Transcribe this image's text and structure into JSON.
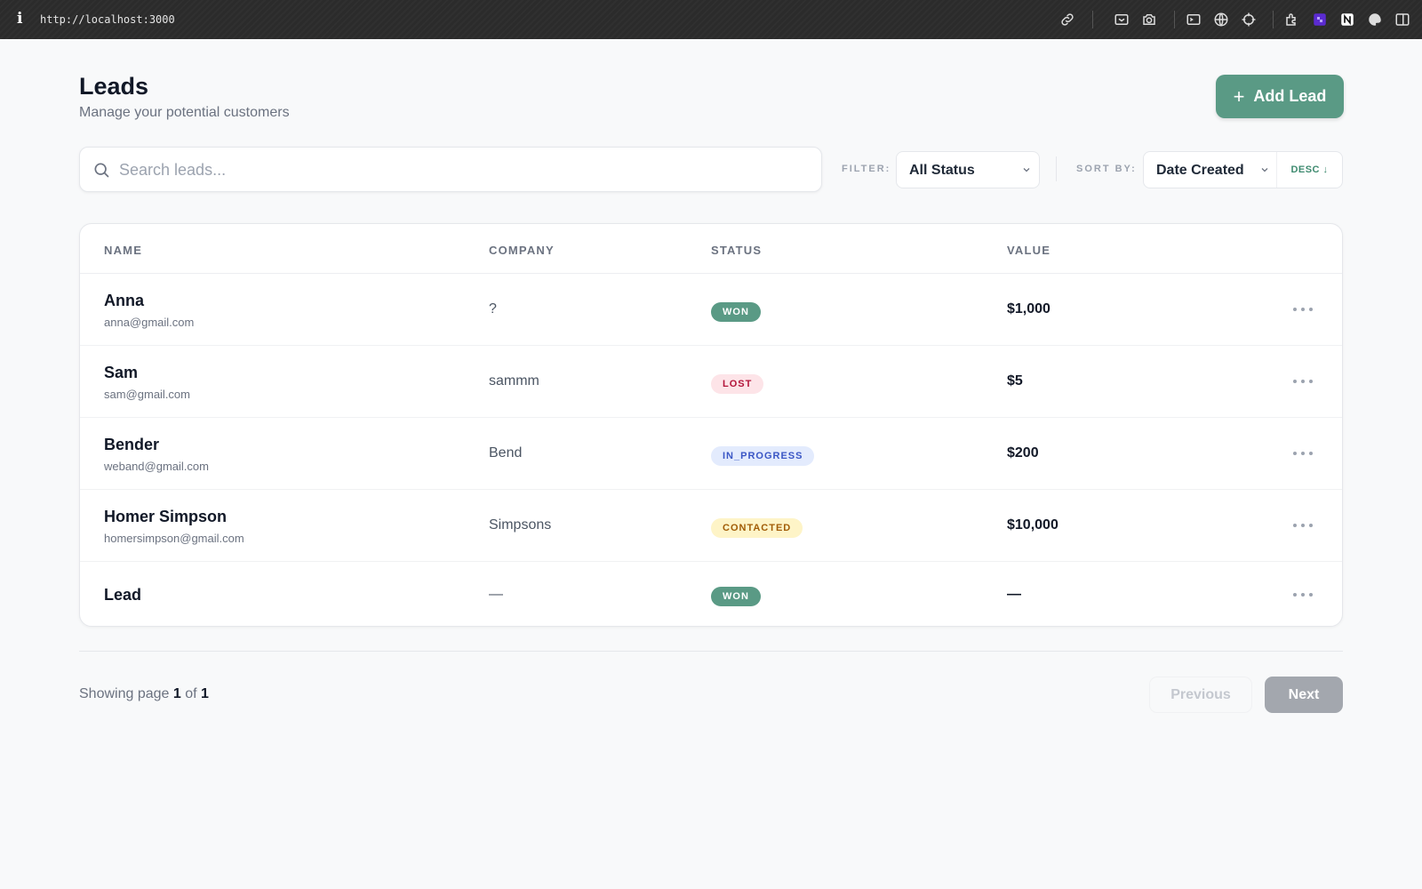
{
  "browser": {
    "url": "http://localhost:3000",
    "icons": [
      "info-icon",
      "link-icon",
      "image-icon",
      "camera-icon",
      "terminal-icon",
      "globe-icon",
      "crosshair-icon",
      "extensions-icon",
      "extension-purple-icon",
      "notion-icon",
      "palette-icon",
      "sidebar-icon"
    ]
  },
  "header": {
    "title": "Leads",
    "subtitle": "Manage your potential customers",
    "add_button": "Add Lead"
  },
  "toolbar": {
    "search_placeholder": "Search leads...",
    "search_value": "",
    "filter_label": "FILTER:",
    "filter_value": "All Status",
    "sort_label": "SORT BY:",
    "sort_value": "Date Created",
    "sort_direction": "DESC ↓"
  },
  "table": {
    "columns": [
      "NAME",
      "COMPANY",
      "STATUS",
      "VALUE"
    ],
    "rows": [
      {
        "name": "Anna",
        "email": "anna@gmail.com",
        "company": "?",
        "status": "WON",
        "value": "$1,000"
      },
      {
        "name": "Sam",
        "email": "sam@gmail.com",
        "company": "sammm",
        "status": "LOST",
        "value": "$5"
      },
      {
        "name": "Bender",
        "email": "weband@gmail.com",
        "company": "Bend",
        "status": "IN_PROGRESS",
        "value": "$200"
      },
      {
        "name": "Homer Simpson",
        "email": "homersimpson@gmail.com",
        "company": "Simpsons",
        "status": "CONTACTED",
        "value": "$10,000"
      },
      {
        "name": "Lead",
        "email": "",
        "company": "—",
        "status": "WON",
        "value": "—"
      }
    ]
  },
  "status_colors": {
    "WON": {
      "bg": "#5a9a85",
      "fg": "#ffffff"
    },
    "LOST": {
      "bg": "#fde4e8",
      "fg": "#b3143a"
    },
    "IN_PROGRESS": {
      "bg": "#e3ebfd",
      "fg": "#3a56c5"
    },
    "CONTACTED": {
      "bg": "#fef4c7",
      "fg": "#a15c07"
    }
  },
  "pagination": {
    "prefix": "Showing page",
    "current": "1",
    "of": "of",
    "total": "1",
    "previous": "Previous",
    "next": "Next"
  },
  "colors": {
    "accent": "#5a9a85",
    "background": "#f8f9fa"
  }
}
